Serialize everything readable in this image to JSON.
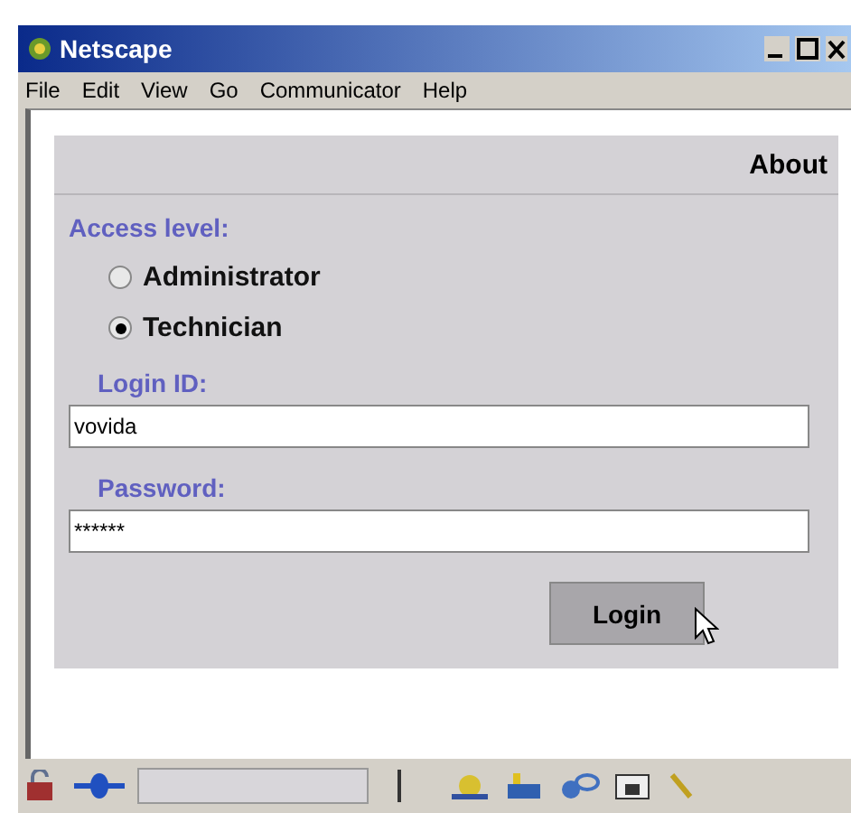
{
  "window": {
    "title": "Netscape"
  },
  "menu": [
    "File",
    "Edit",
    "View",
    "Go",
    "Communicator",
    "Help"
  ],
  "header": {
    "link": "About"
  },
  "access": {
    "label": "Access level:",
    "options": [
      {
        "label": "Administrator",
        "selected": false
      },
      {
        "label": "Technician",
        "selected": true
      }
    ]
  },
  "fields": [
    {
      "label": "Login ID:",
      "value": "vovida"
    },
    {
      "label": "Password:",
      "value": "******"
    }
  ],
  "button": "Login"
}
